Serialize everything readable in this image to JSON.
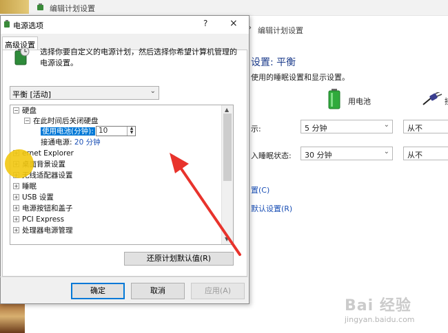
{
  "background_window": {
    "title": "编辑计划设置",
    "breadcrumb": "编辑计划设置",
    "heading": "设置: 平衡",
    "subtitle": "使用的睡眠设置和显示设置。",
    "battery_label": "用电池",
    "plugged_label": "接",
    "rows": [
      {
        "label": "示:",
        "battery": "5 分钟",
        "plugged": "从不"
      },
      {
        "label": "入睡眠状态:",
        "battery": "30 分钟",
        "plugged": "从不"
      }
    ],
    "link_change_advanced": "置(C)",
    "link_restore_default": "默认设置(R)"
  },
  "dialog": {
    "title": "电源选项",
    "help": "?",
    "close": "×",
    "tab": "高级设置",
    "description": "选择你要自定义的电源计划，然后选择你希望计算机管理的电源设置。",
    "plan_selected": "平衡 [活动]",
    "tree": {
      "hard_disk": "硬盘",
      "turn_off_after": "在此时间后关闭硬盘",
      "on_battery_label": "使用电池(分钟):",
      "on_battery_value": "10",
      "plugged_in_label": "接通电源:",
      "plugged_in_value": "20 分钟",
      "items": [
        "ernet Explorer",
        "桌面背景设置",
        "无线适配器设置",
        "睡眠",
        "USB 设置",
        "电源按钮和盖子",
        "PCI Express",
        "处理器电源管理"
      ]
    },
    "restore_button": "还原计划默认值(R)",
    "ok_button": "确定",
    "cancel_button": "取消",
    "apply_button": "应用(A)"
  },
  "watermark": {
    "logo": "Bai 经验",
    "url": "jingyan.baidu.com"
  },
  "colors": {
    "accent": "#0078d7",
    "annotation_arrow": "#e8332c",
    "annotation_dot": "#f2c811"
  }
}
